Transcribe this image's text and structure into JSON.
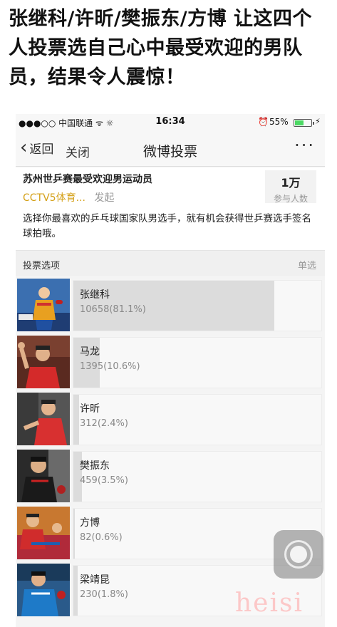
{
  "headline": "张继科/许昕/樊振东/方博 让这四个人投票选自己心中最受欢迎的男队员，结果令人震惊！",
  "status_bar": {
    "carrier": "●●●○○ 中国联通 ᯤ ☼",
    "time": "16:34",
    "alarm_icon": "⏰",
    "battery_pct": "55%",
    "battery_level": 0.55
  },
  "nav": {
    "back_label": "返回",
    "close_label": "关闭",
    "title": "微博投票",
    "more_label": "···"
  },
  "vote": {
    "title": "苏州世乒赛最受欢迎男运动员",
    "source": "CCTV5体育...",
    "initiated": "发起",
    "participant_count": "1万",
    "participant_label": "参与人数",
    "description": "选择你最喜欢的乒乓球国家队男选手，就有机会获得世乒赛选手签名球拍哦。"
  },
  "options_header": {
    "label": "投票选项",
    "mode": "单选"
  },
  "options": [
    {
      "name": "张继科",
      "stat": "10658(81.1%)",
      "percent": 81.1,
      "photo": "player-photo"
    },
    {
      "name": "马龙",
      "stat": "1395(10.6%)",
      "percent": 10.6,
      "photo": "player-photo"
    },
    {
      "name": "许昕",
      "stat": "312(2.4%)",
      "percent": 2.4,
      "photo": "player-photo"
    },
    {
      "name": "樊振东",
      "stat": "459(3.5%)",
      "percent": 3.5,
      "photo": "player-photo"
    },
    {
      "name": "方博",
      "stat": "82(0.6%)",
      "percent": 0.6,
      "photo": "player-photo"
    },
    {
      "name": "梁靖昆",
      "stat": "230(1.8%)",
      "percent": 1.8,
      "photo": "player-photo"
    }
  ],
  "watermark": "heisi"
}
